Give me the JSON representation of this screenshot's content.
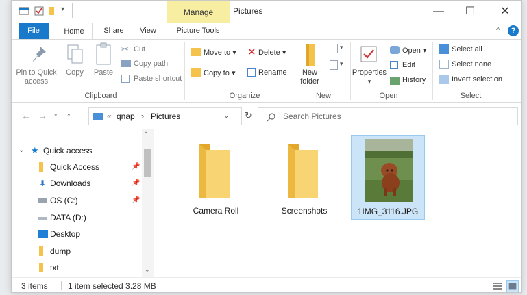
{
  "titlebar": {
    "context_tab": "Manage",
    "title": "Pictures",
    "minimize": "—",
    "maximize": "☐",
    "close": "✕"
  },
  "tabs": [
    {
      "label": "File"
    },
    {
      "label": "Home"
    },
    {
      "label": "Share"
    },
    {
      "label": "View"
    },
    {
      "label": "Picture Tools"
    }
  ],
  "help_label": "?",
  "ribbon": {
    "clipboard": {
      "pin_label_1": "Pin to Quick",
      "pin_label_2": "access",
      "copy": "Copy",
      "paste": "Paste",
      "cut": "Cut",
      "copy_path": "Copy path",
      "paste_shortcut": "Paste shortcut",
      "group": "Clipboard"
    },
    "organize": {
      "move_to": "Move to",
      "copy_to": "Copy to",
      "delete": "Delete",
      "rename": "Rename",
      "group": "Organize"
    },
    "new": {
      "new_folder_1": "New",
      "new_folder_2": "folder",
      "group": "New"
    },
    "open": {
      "properties": "Properties",
      "open": "Open",
      "edit": "Edit",
      "history": "History",
      "group": "Open"
    },
    "select": {
      "select_all": "Select all",
      "select_none": "Select none",
      "invert": "Invert selection",
      "group": "Select"
    }
  },
  "address": {
    "overflow": "«",
    "crumbs": [
      "qnap",
      "Pictures"
    ],
    "sep": "›",
    "search_placeholder": "Search Pictures"
  },
  "nav": [
    {
      "label": "Quick access",
      "icon": "star-icon"
    },
    {
      "label": "Quick Access",
      "icon": "folder-icon"
    },
    {
      "label": "Downloads",
      "icon": "download-icon"
    },
    {
      "label": "OS (C:)",
      "icon": "drive-icon"
    },
    {
      "label": "DATA (D:)",
      "icon": "drive-icon"
    },
    {
      "label": "Desktop",
      "icon": "desktop-icon"
    },
    {
      "label": "dump",
      "icon": "folder-icon"
    },
    {
      "label": "txt",
      "icon": "folder-icon"
    }
  ],
  "files": [
    {
      "name": "Camera Roll",
      "type": "folder"
    },
    {
      "name": "Screenshots",
      "type": "folder"
    },
    {
      "name": "1IMG_3116.JPG",
      "type": "image",
      "selected": true
    }
  ],
  "status": {
    "count": "3 items",
    "selection": "1 item selected  3.28 MB"
  },
  "colors": {
    "accent": "#1979ca",
    "folder": "#f5c24c",
    "manage_tab": "#f8eea1",
    "selection": "#cce4f7"
  }
}
